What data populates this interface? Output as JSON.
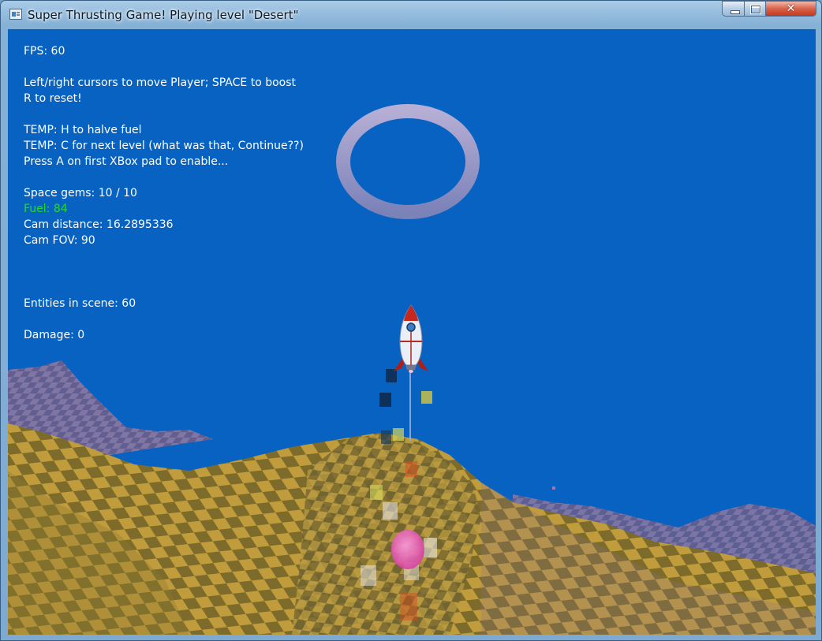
{
  "window": {
    "title": "Super Thrusting Game! Playing level \"Desert\"",
    "close_glyph": "✕"
  },
  "hud": {
    "fps": "FPS: 60",
    "controls_line1": "Left/right cursors to move Player; SPACE to boost",
    "controls_line2": "R to reset!",
    "temp_line1": "TEMP: H to halve fuel",
    "temp_line2": "TEMP: C for next level (what was that, Continue??)",
    "temp_line3": "Press A on first XBox pad to enable...",
    "space_gems": "Space gems: 10 / 10",
    "fuel": "Fuel: 84",
    "cam_distance": "Cam distance: 16.2895336",
    "cam_fov": "Cam FOV: 90",
    "entities": "Entities in scene: 60",
    "damage": "Damage: 0"
  },
  "colors": {
    "sky": "#0762c2",
    "fuel_text": "#22dd22",
    "hud_text": "#ffffff",
    "terrain_light": "#b8963a",
    "terrain_dark": "#7d6a2c"
  }
}
